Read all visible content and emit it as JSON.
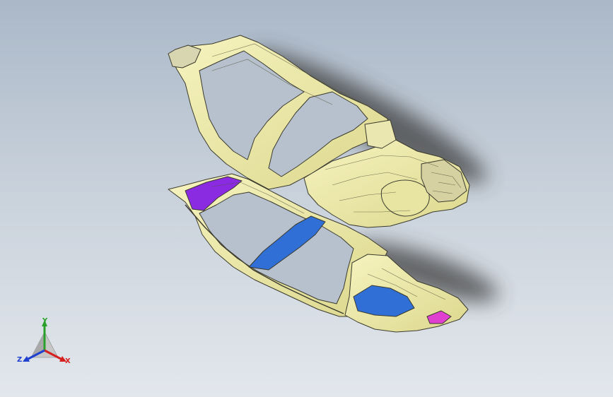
{
  "viewport": {
    "background_top": "#aab8c8",
    "background_bottom": "#e3e7ec"
  },
  "model": {
    "body_color": "#f0eda8",
    "edge_color": "#3a3a2e",
    "accent_blue": "#2f6fd6",
    "accent_purple": "#8a2be2",
    "accent_magenta": "#e040d0"
  },
  "triad": {
    "x_label": "X",
    "y_label": "Y",
    "z_label": "Z",
    "x_color": "#d62020",
    "y_color": "#2aa02a",
    "z_color": "#2040d0"
  }
}
